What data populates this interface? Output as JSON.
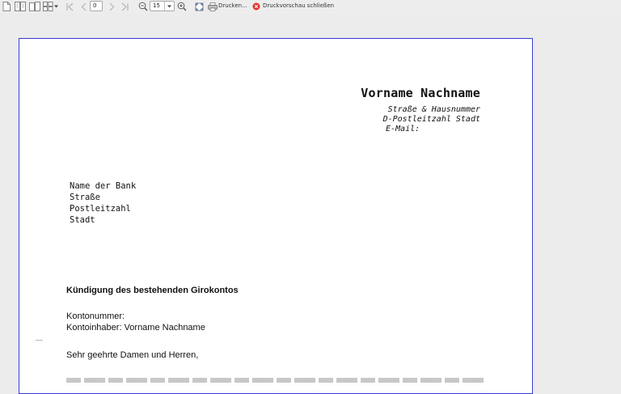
{
  "toolbar": {
    "icons": [
      "single-page-icon",
      "facing-pages-icon",
      "book-view-icon",
      "multi-page-icon",
      "first-page-icon",
      "previous-page-icon",
      "next-page-icon",
      "last-page-icon",
      "zoom-out-icon",
      "zoom-in-icon",
      "full-screen-icon",
      "printer-icon",
      "close-circle-icon"
    ],
    "page_number": "0",
    "zoom_value": "15",
    "print_label": "Drucken...",
    "close_label": "Druckvorschau schließen",
    "close_color": "#e0302a"
  },
  "document": {
    "sender": {
      "name": "Vorname Nachname",
      "street": "Straße & Hausnummer",
      "city": "D-Postleitzahl Stadt",
      "email": "E-Mail:"
    },
    "recipient": {
      "bank": "Name der Bank",
      "street": "Straße",
      "postal": "Postleitzahl",
      "city": "Stadt"
    },
    "subject": "Kündigung des bestehenden Girokontos",
    "account_number": "Kontonummer:",
    "account_holder": "Kontoinhaber: Vorname Nachname",
    "salutation": "Sehr geehrte Damen und Herren,"
  },
  "colors": {
    "page_border": "#3a3ad8",
    "workspace": "#ececec"
  }
}
